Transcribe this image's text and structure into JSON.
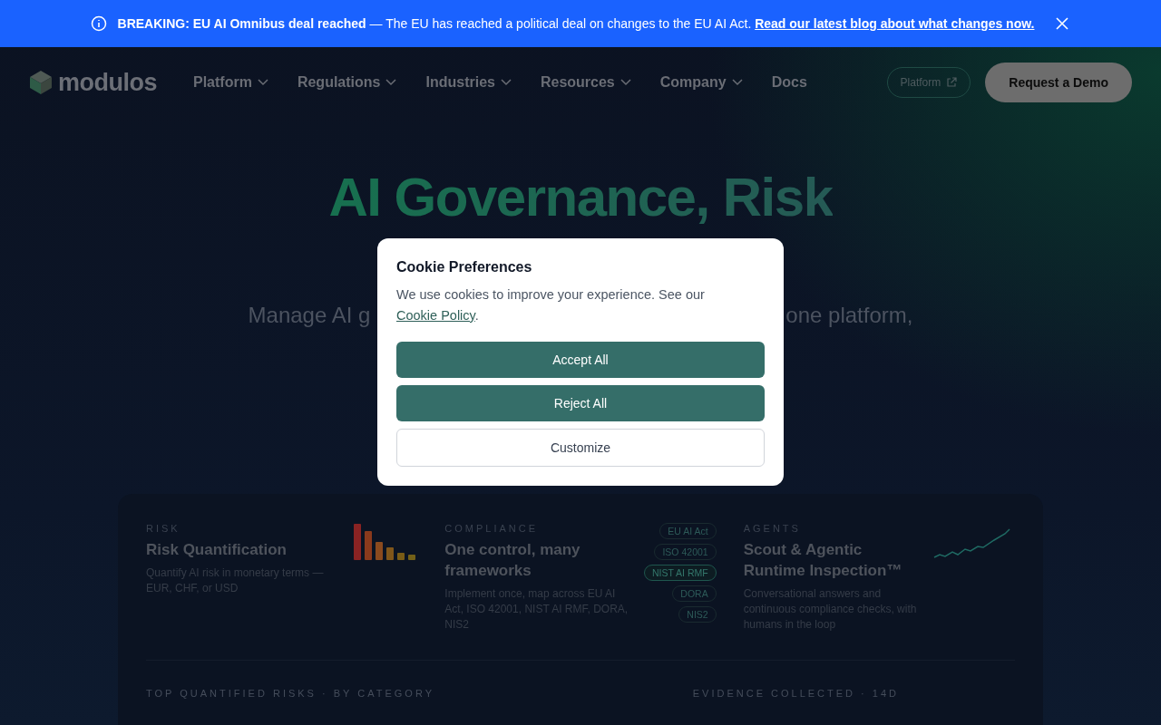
{
  "banner": {
    "text": "**BREAKING: EU AI Omnibus deal reached** — The EU has reached a political deal on changes to the EU AI Act.",
    "link": "Read our latest blog about what changes now."
  },
  "nav": {
    "logo": "modulos",
    "items": [
      {
        "label": "Platform",
        "dropdown": true
      },
      {
        "label": "Regulations",
        "dropdown": true
      },
      {
        "label": "Industries",
        "dropdown": true
      },
      {
        "label": "Resources",
        "dropdown": true
      },
      {
        "label": "Company",
        "dropdown": true
      },
      {
        "label": "Docs",
        "dropdown": false
      }
    ],
    "buttons": [
      {
        "label": "Platform",
        "kind": "outline"
      },
      {
        "label": "Request a Demo",
        "kind": "solid"
      }
    ]
  },
  "hero": {
    "title": "AI Governance, Risk",
    "subtitle_fragments": [
      "Manage AI g",
      "one platform,"
    ]
  },
  "features": [
    {
      "kind": "bars",
      "eyebrow": "RISK",
      "title": "Risk Quantification",
      "description": "Quantify AI risk in monetary terms — EUR, CHF, or USD"
    },
    {
      "kind": "tags",
      "eyebrow": "COMPLIANCE",
      "title": "One control, many frameworks",
      "description": "Implement once, map across EU AI Act, ISO 42001, NIST AI RMF, DORA, NIS2",
      "tags": [
        {
          "label": "EU AI Act",
          "selected": false
        },
        {
          "label": "ISO 42001",
          "selected": false
        },
        {
          "label": "NIST AI RMF",
          "selected": true
        },
        {
          "label": "DORA",
          "selected": false
        },
        {
          "label": "NIS2",
          "selected": false
        }
      ]
    },
    {
      "kind": "line",
      "eyebrow": "AGENTS",
      "title": "Scout & Agentic Runtime Inspection™",
      "description": "Conversational answers and continuous compliance checks, with humans in the loop"
    }
  ],
  "sections": [
    "TOP QUANTIFIED RISKS · BY CATEGORY",
    "EVIDENCE COLLECTED · 14D"
  ],
  "cookie": {
    "title": "Cookie Preferences",
    "text": "We use cookies to improve your experience. See our",
    "link": "Cookie Policy",
    "after_link": ".",
    "buttons": [
      {
        "label": "Accept All",
        "kind": "primary"
      },
      {
        "label": "Reject All",
        "kind": "primary"
      },
      {
        "label": "Customize",
        "kind": "outline"
      }
    ]
  }
}
